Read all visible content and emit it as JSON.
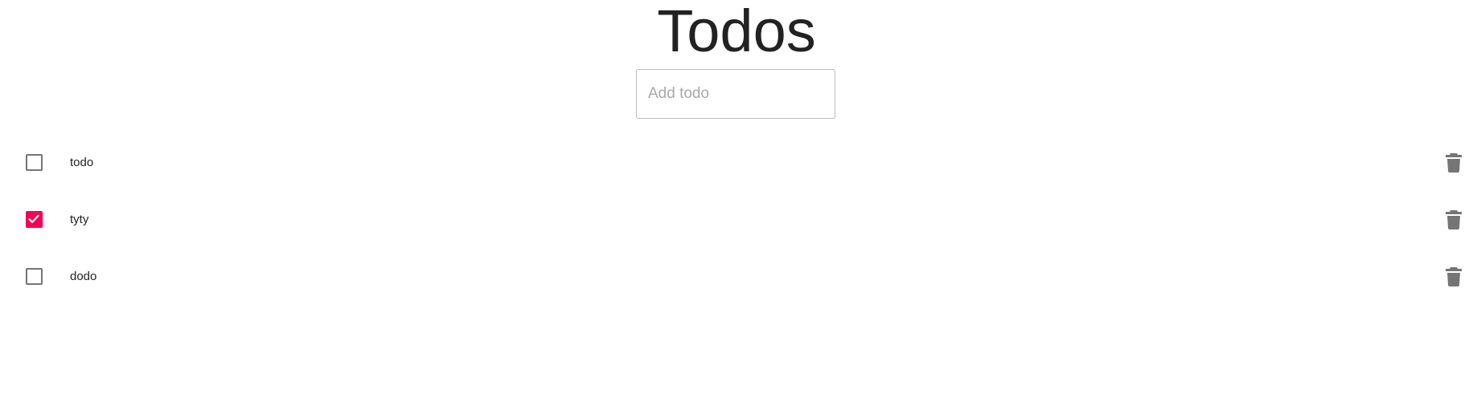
{
  "header": {
    "title": "Todos"
  },
  "add_todo": {
    "placeholder": "Add todo",
    "value": ""
  },
  "todos": [
    {
      "text": "todo",
      "completed": false
    },
    {
      "text": "tyty",
      "completed": true
    },
    {
      "text": "dodo",
      "completed": false
    }
  ],
  "icons": {
    "delete": "trash-icon",
    "check": "check-icon"
  },
  "colors": {
    "checked": "#f50057",
    "unchecked_border": "#757575",
    "icon": "#757575",
    "text": "#222222",
    "placeholder": "#a8a8a8",
    "input_border": "#bdbdbd"
  }
}
